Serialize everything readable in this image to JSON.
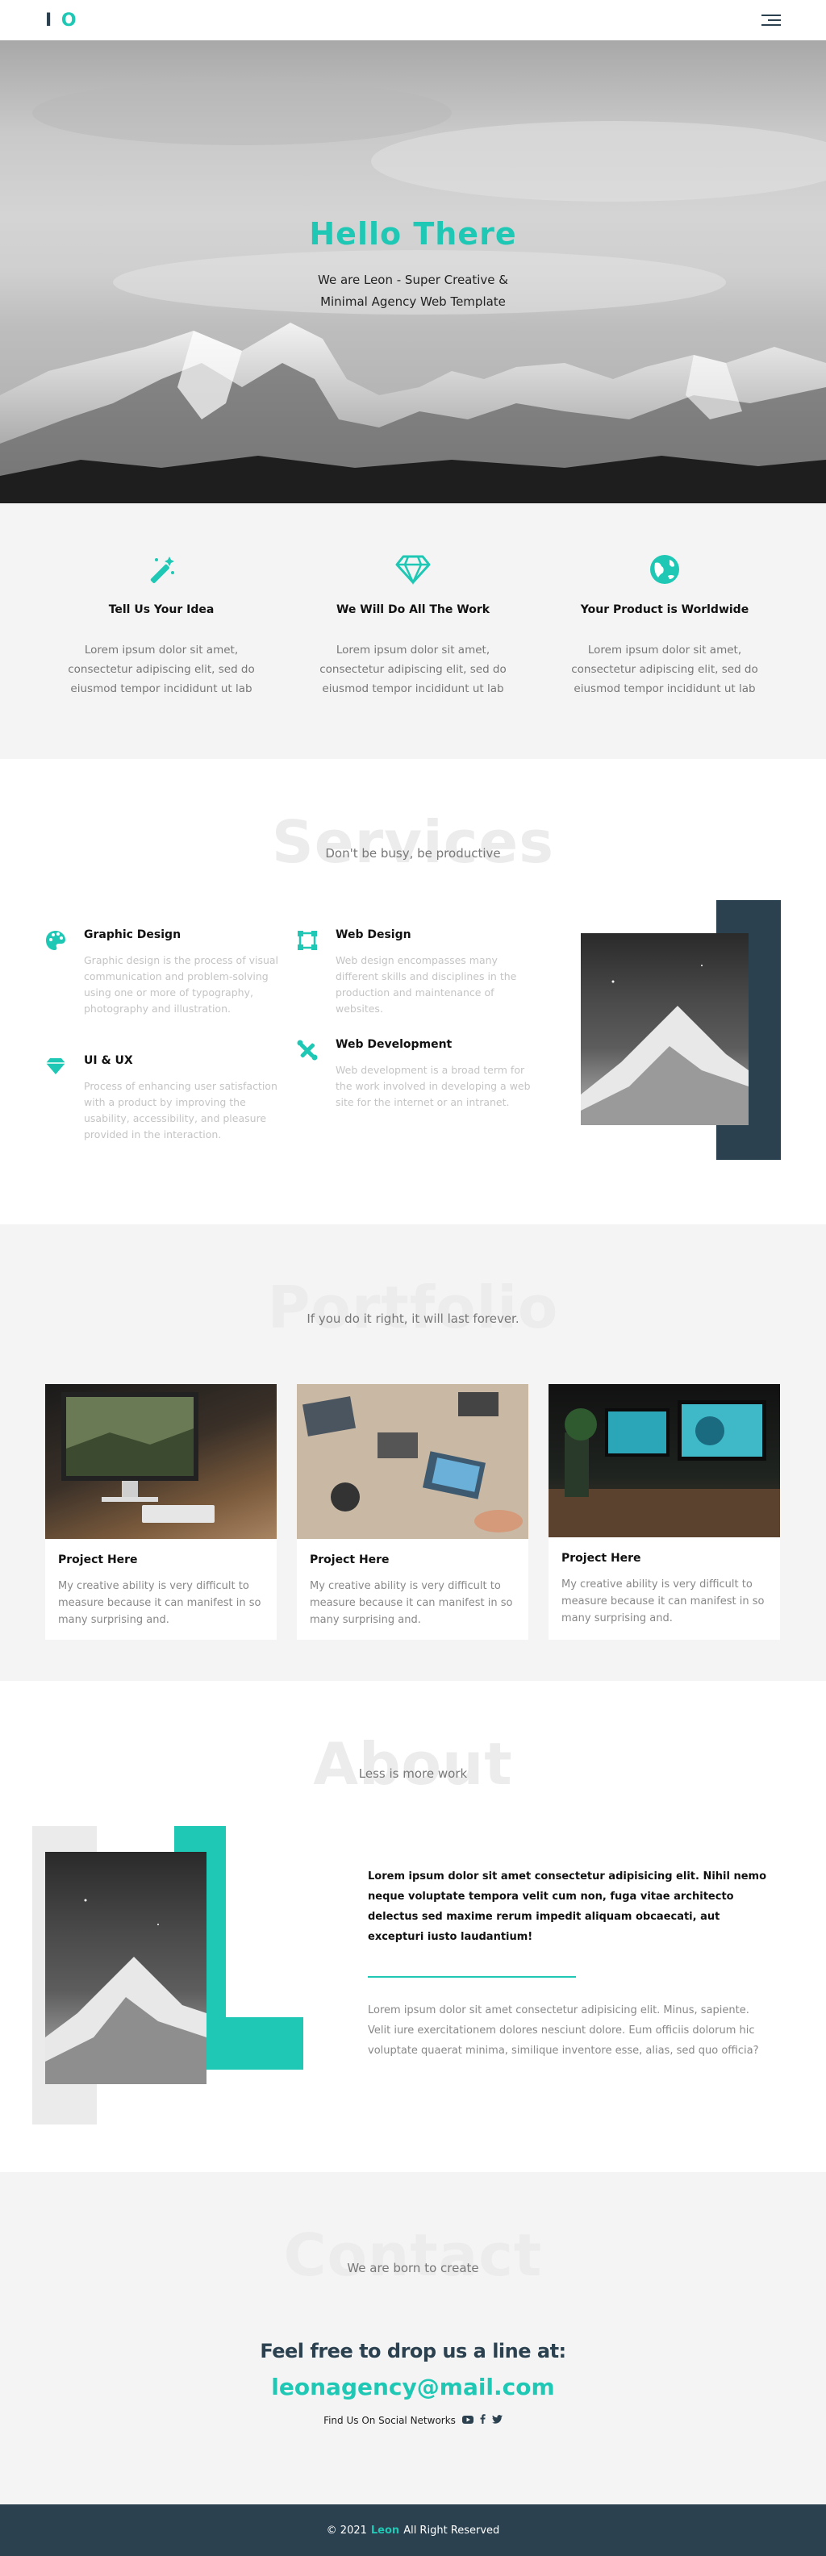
{
  "nav": {
    "logo_bar": "I",
    "logo_o": "O",
    "menu_icon": "hamburger-icon"
  },
  "hero": {
    "title": "Hello There",
    "subtitle_line1": "We are Leon - Super Creative &",
    "subtitle_line2": "Minimal Agency Web Template"
  },
  "features": [
    {
      "icon": "magic-wand-icon",
      "title": "Tell Us Your Idea",
      "text": "Lorem ipsum dolor sit amet, consectetur adipiscing elit, sed do eiusmod tempor incididunt ut lab"
    },
    {
      "icon": "diamond-icon",
      "title": "We Will Do All The Work",
      "text": "Lorem ipsum dolor sit amet, consectetur adipiscing elit, sed do eiusmod tempor incididunt ut lab"
    },
    {
      "icon": "globe-icon",
      "title": "Your Product is Worldwide",
      "text": "Lorem ipsum dolor sit amet, consectetur adipiscing elit, sed do eiusmod tempor incididunt ut lab"
    }
  ],
  "services": {
    "ghost": "Services",
    "subtitle": "Don't be busy, be productive",
    "items": [
      {
        "icon": "palette-icon",
        "title": "Graphic Design",
        "text": "Graphic design is the process of visual communication and problem-solving using one or more of typography, photography and illustration."
      },
      {
        "icon": "vector-nodes-icon",
        "title": "Web Design",
        "text": "Web design encompasses many different skills and disciplines in the production and maintenance of websites."
      },
      {
        "icon": "diamond-icon",
        "title": "UI & UX",
        "text": "Process of enhancing user satisfaction with a product by improving the usability, accessibility, and pleasure provided in the interaction."
      },
      {
        "icon": "tools-icon",
        "title": "Web Development",
        "text": "Web development is a broad term for the work involved in developing a web site for the internet or an intranet."
      }
    ]
  },
  "portfolio": {
    "ghost": "Portfolio",
    "subtitle": "If you do it right, it will last forever.",
    "cards": [
      {
        "title": "Project Here",
        "text": "My creative ability is very difficult to measure because it can manifest in so many surprising and."
      },
      {
        "title": "Project Here",
        "text": "My creative ability is very difficult to measure because it can manifest in so many surprising and."
      },
      {
        "title": "Project Here",
        "text": "My creative ability is very difficult to measure because it can manifest in so many surprising and."
      }
    ]
  },
  "about": {
    "ghost": "About",
    "subtitle": "Less is more work",
    "bold_text": "Lorem ipsum dolor sit amet consectetur adipisicing elit. Nihil nemo neque voluptate tempora velit cum non, fuga vitae architecto delectus sed maxime rerum impedit aliquam obcaecati, aut excepturi iusto laudantium!",
    "light_text": "Lorem ipsum dolor sit amet consectetur adipisicing elit. Minus, sapiente. Velit iure exercitationem dolores nesciunt dolore. Eum officiis dolorum hic voluptate quaerat minima, similique inventore esse, alias, sed quo officia?"
  },
  "contact": {
    "ghost": "Contact",
    "subtitle": "We are born to create",
    "headline": "Feel free to drop us a line at:",
    "email": "leonagency@mail.com",
    "social_label": "Find Us On Social Networks",
    "social_icons": [
      "youtube-icon",
      "facebook-icon",
      "twitter-icon"
    ]
  },
  "footer": {
    "prefix": "© 2021",
    "brand": "Leon",
    "suffix": "All Right Reserved"
  },
  "colors": {
    "accent": "#1ec8b4",
    "dark": "#2b4150",
    "light_bg": "#f4f4f4"
  }
}
